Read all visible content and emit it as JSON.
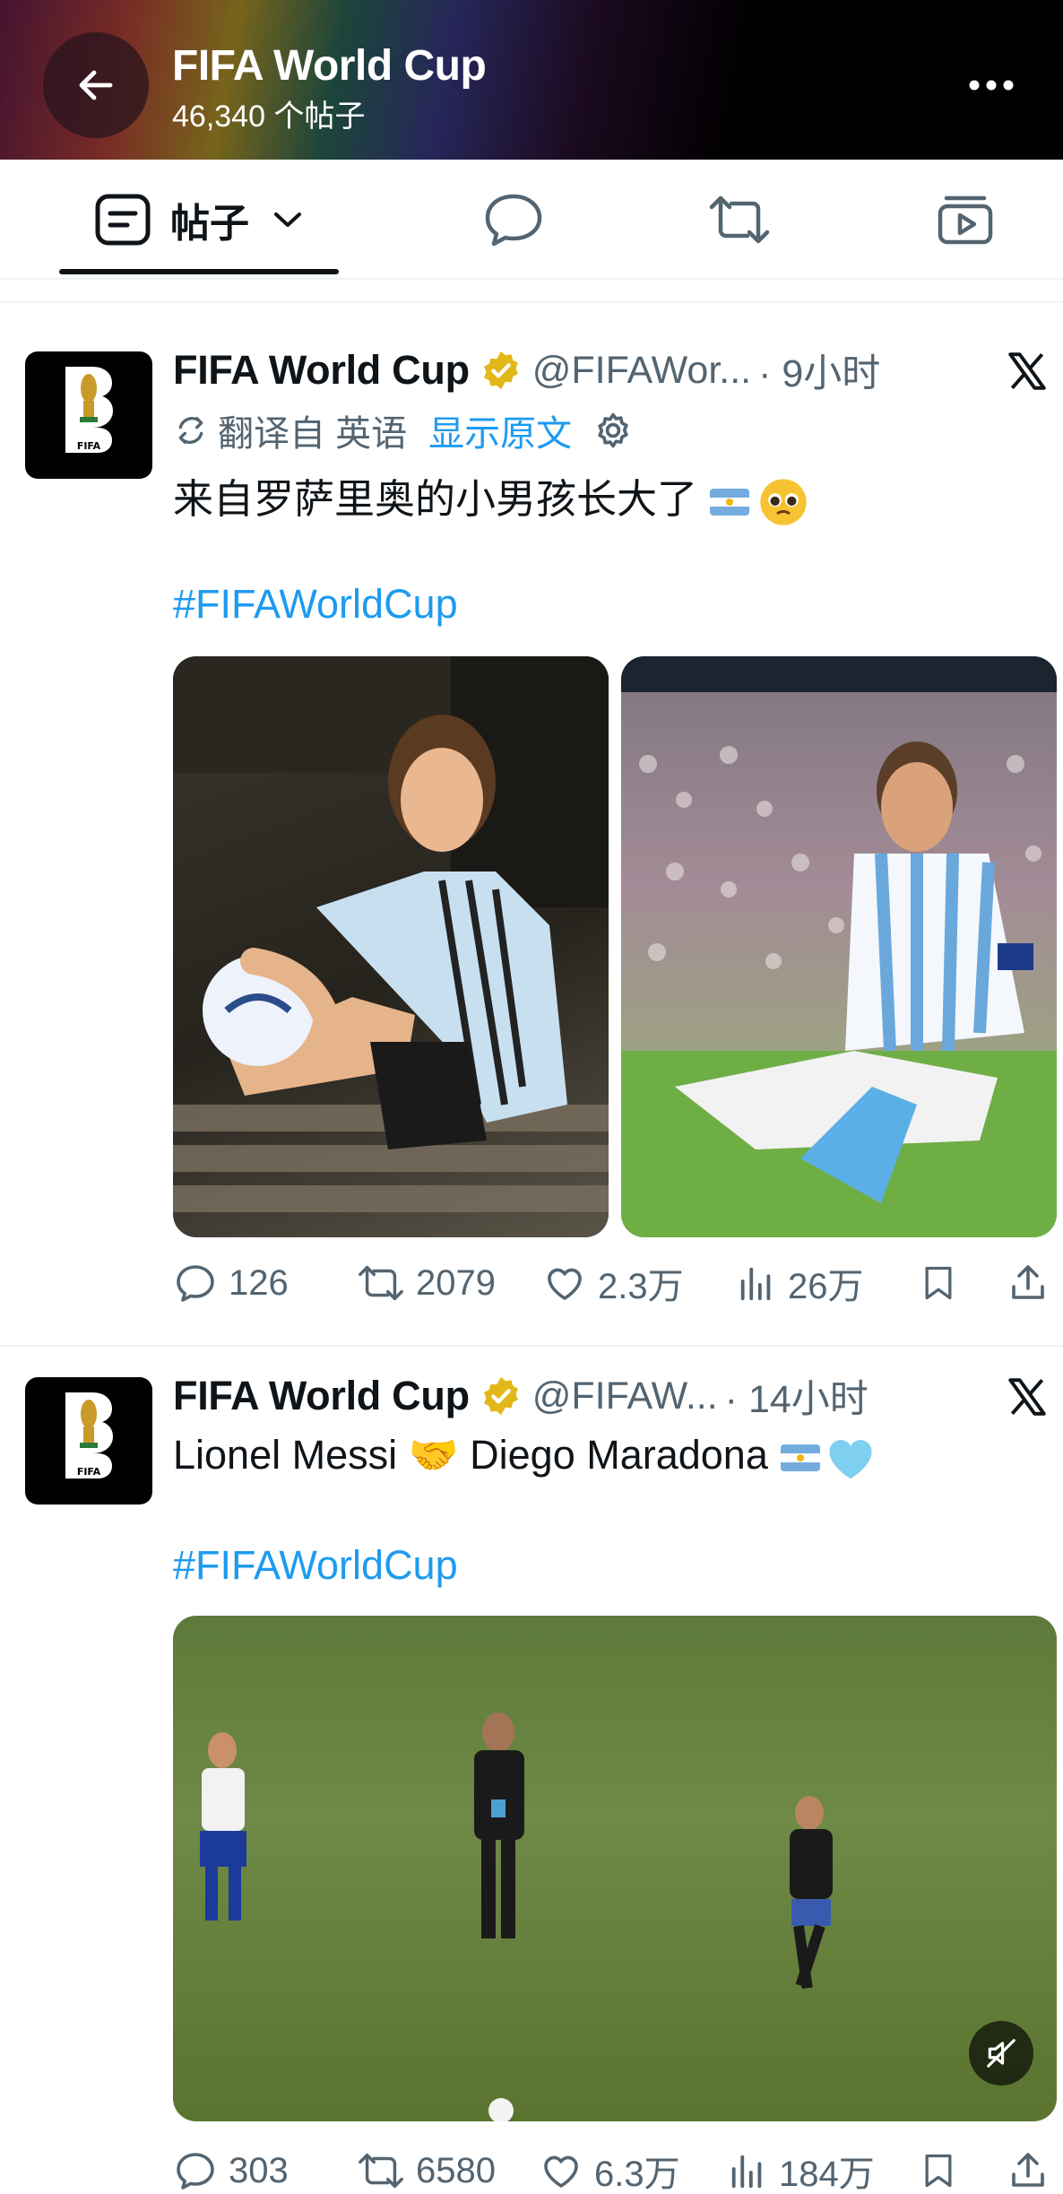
{
  "header": {
    "title": "FIFA World Cup",
    "subtitle": "46,340 个帖子"
  },
  "tabs": [
    {
      "label": "帖子",
      "icon": "posts-icon",
      "active": true
    },
    {
      "label": "",
      "icon": "reply-icon"
    },
    {
      "label": "",
      "icon": "repost-icon"
    },
    {
      "label": "",
      "icon": "media-icon"
    }
  ],
  "tweets": [
    {
      "name": "FIFA World Cup",
      "handle": "@FIFAWor...",
      "time": "· 9小时",
      "translated_label": "翻译自 英语",
      "show_original": "显示原文",
      "text": "来自罗萨里奥的小男孩长大了",
      "hashtag": "#FIFAWorldCup",
      "stats": {
        "replies": "126",
        "reposts": "2079",
        "likes": "2.3万",
        "views": "26万"
      }
    },
    {
      "name": "FIFA World Cup",
      "handle": "@FIFAW...",
      "time": "· 14小时",
      "text": "Lionel Messi 🤝 Diego Maradona",
      "hashtag": "#FIFAWorldCup",
      "stats": {
        "replies": "303",
        "reposts": "6580",
        "likes": "6.3万",
        "views": "184万"
      }
    }
  ],
  "colors": {
    "accent": "#1d9bf0",
    "text": "#0f1419",
    "secondary": "#536471",
    "verified": "#e2b719"
  }
}
